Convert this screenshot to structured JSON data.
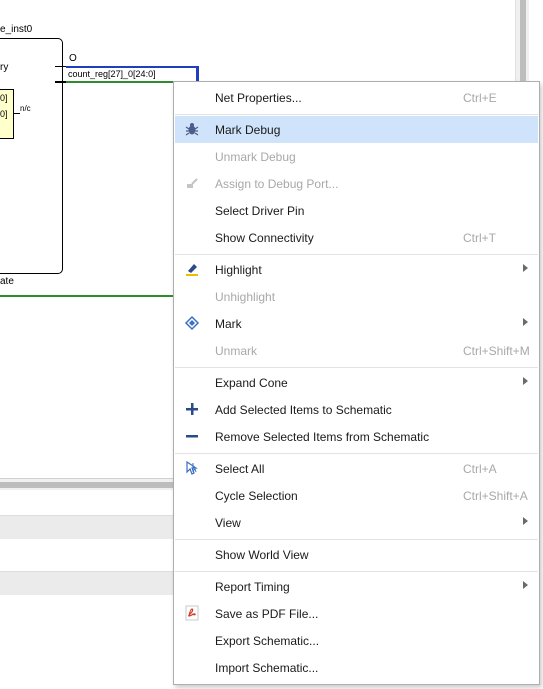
{
  "schematic": {
    "instance_label": "e_inst0",
    "pin_left_label": "ry",
    "pin_o_label": "O",
    "net_label": "count_reg[27]_0[24:0]",
    "inner_label_top": "0]",
    "inner_label_bottom": "0]",
    "nc_label": "n/c",
    "bottom_label": "ate"
  },
  "colors": {
    "selected_net": "#1f3fbf",
    "green_net": "#2e8b2e",
    "menu_highlight": "#cfe3fa",
    "disabled_text": "#a8a8a8"
  },
  "menu": {
    "items": [
      {
        "label": "Net Properties...",
        "shortcut": "Ctrl+E",
        "icon": "",
        "disabled": false,
        "submenu": false
      },
      {
        "label": "Mark Debug",
        "shortcut": "",
        "icon": "bug-icon",
        "disabled": false,
        "submenu": false,
        "selected": true
      },
      {
        "label": "Unmark Debug",
        "shortcut": "",
        "icon": "",
        "disabled": true,
        "submenu": false
      },
      {
        "label": "Assign to Debug Port...",
        "shortcut": "",
        "icon": "assign-debug-icon",
        "disabled": true,
        "submenu": false
      },
      {
        "label": "Select Driver Pin",
        "shortcut": "",
        "icon": "",
        "disabled": false,
        "submenu": false
      },
      {
        "label": "Show Connectivity",
        "shortcut": "Ctrl+T",
        "icon": "",
        "disabled": false,
        "submenu": false
      },
      {
        "label": "Highlight",
        "shortcut": "",
        "icon": "highlighter-icon",
        "disabled": false,
        "submenu": true
      },
      {
        "label": "Unhighlight",
        "shortcut": "",
        "icon": "",
        "disabled": true,
        "submenu": false
      },
      {
        "label": "Mark",
        "shortcut": "",
        "icon": "diamond-mark-icon",
        "disabled": false,
        "submenu": true
      },
      {
        "label": "Unmark",
        "shortcut": "Ctrl+Shift+M",
        "icon": "",
        "disabled": true,
        "submenu": false
      },
      {
        "label": "Expand Cone",
        "shortcut": "",
        "icon": "",
        "disabled": false,
        "submenu": true
      },
      {
        "label": "Add Selected Items to Schematic",
        "shortcut": "",
        "icon": "plus-icon",
        "disabled": false,
        "submenu": false
      },
      {
        "label": "Remove Selected Items from Schematic",
        "shortcut": "",
        "icon": "minus-icon",
        "disabled": false,
        "submenu": false
      },
      {
        "label": "Select All",
        "shortcut": "Ctrl+A",
        "icon": "select-all-icon",
        "disabled": false,
        "submenu": false
      },
      {
        "label": "Cycle Selection",
        "shortcut": "Ctrl+Shift+A",
        "icon": "",
        "disabled": false,
        "submenu": false
      },
      {
        "label": "View",
        "shortcut": "",
        "icon": "",
        "disabled": false,
        "submenu": true
      },
      {
        "label": "Show World View",
        "shortcut": "",
        "icon": "",
        "disabled": false,
        "submenu": false
      },
      {
        "label": "Report Timing",
        "shortcut": "",
        "icon": "",
        "disabled": false,
        "submenu": true
      },
      {
        "label": "Save as PDF File...",
        "shortcut": "",
        "icon": "pdf-icon",
        "disabled": false,
        "submenu": false
      },
      {
        "label": "Export Schematic...",
        "shortcut": "",
        "icon": "",
        "disabled": false,
        "submenu": false
      },
      {
        "label": "Import Schematic...",
        "shortcut": "",
        "icon": "",
        "disabled": false,
        "submenu": false
      }
    ]
  }
}
